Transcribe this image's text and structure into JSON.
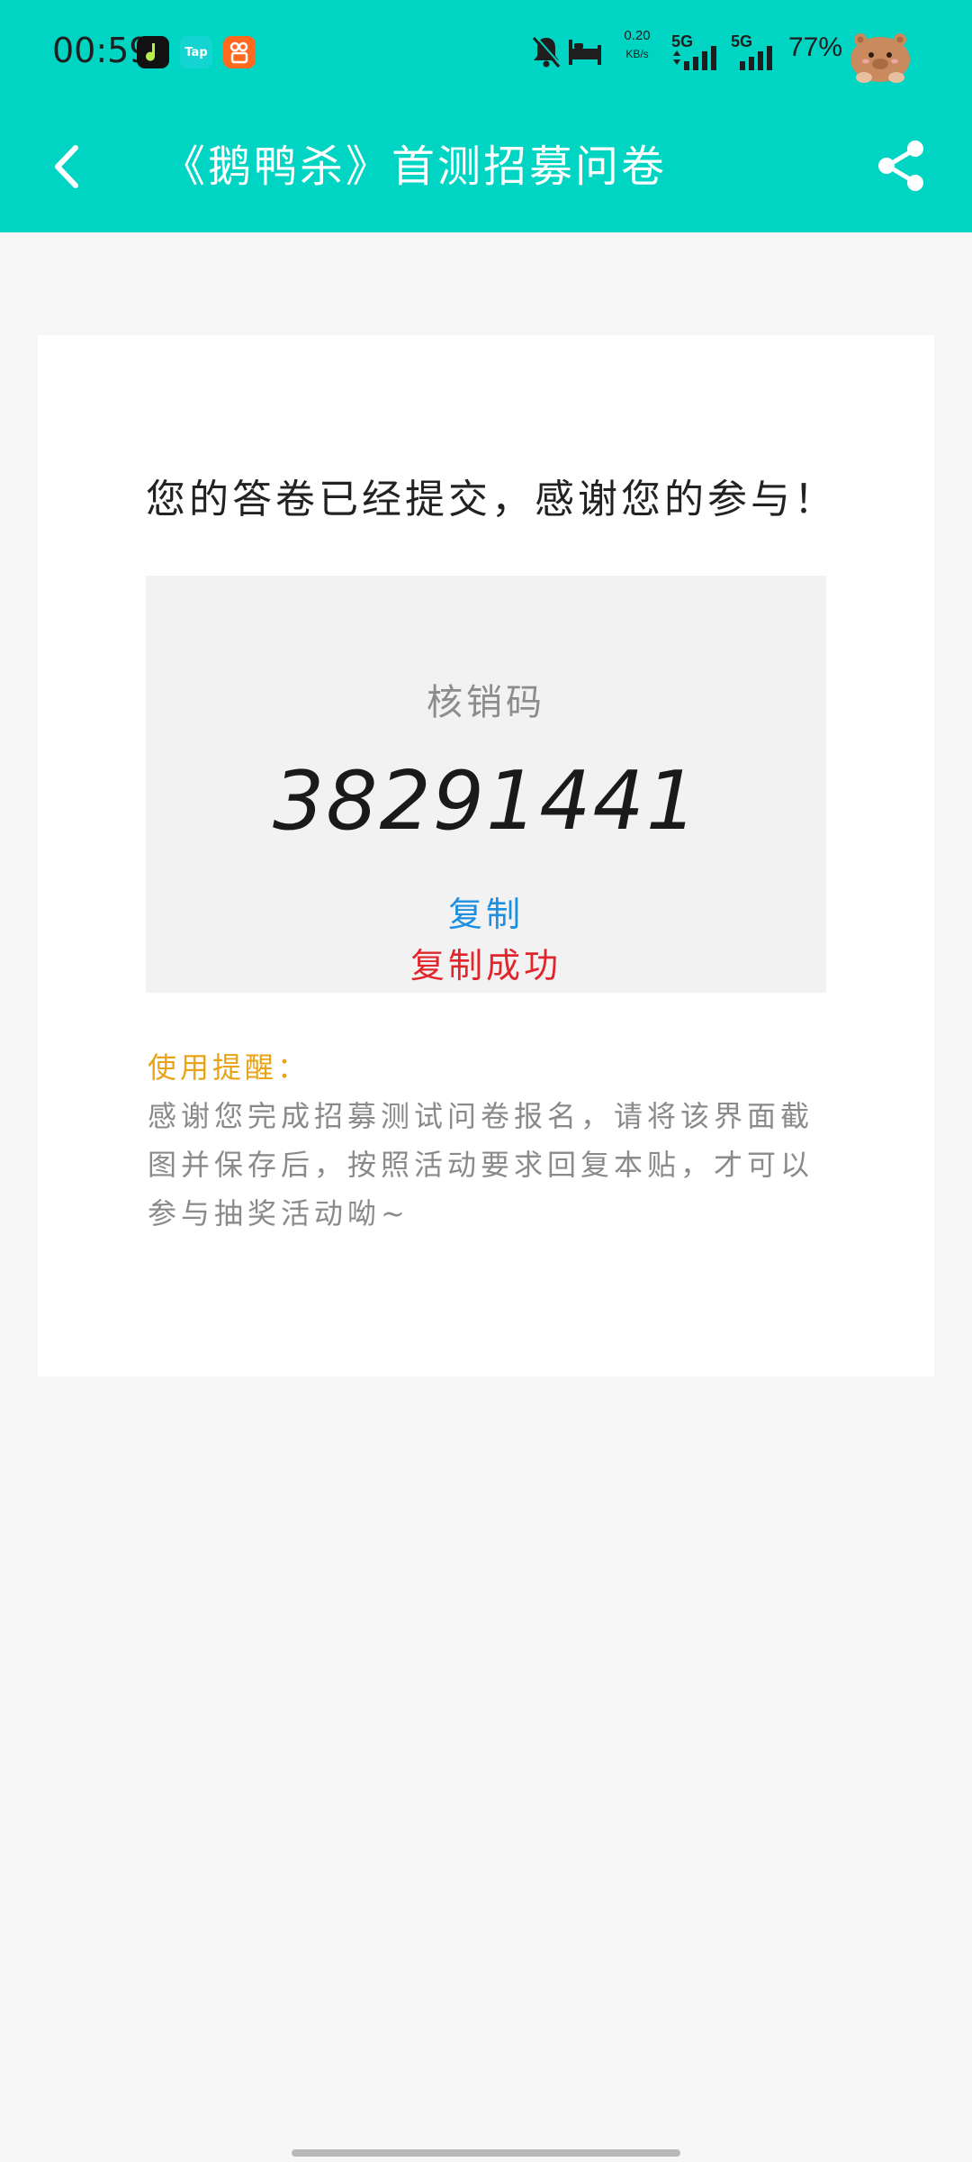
{
  "status_bar": {
    "time": "00:59",
    "tap_icon_text": "Tap",
    "net_speed_value": "0.20",
    "net_speed_unit": "KB/s",
    "sim1_label": "5G",
    "sim2_label": "5G",
    "battery": "77%"
  },
  "nav": {
    "title": "《鹅鸭杀》首测招募问卷"
  },
  "content": {
    "success_message": "您的答卷已经提交，感谢您的参与！",
    "code_label": "核销码",
    "code_value": "38291441",
    "copy_label": "复制",
    "copy_status": "复制成功",
    "reminder_title": "使用提醒：",
    "reminder_body": "感谢您完成招募测试问卷报名，请将该界面截图并保存后，按照活动要求回复本贴，才可以参与抽奖活动呦~"
  },
  "colors": {
    "header_bg": "#00d4c3",
    "copy_link": "#1c8fe0",
    "copy_success": "#e0262c",
    "reminder_title": "#e8a317"
  }
}
